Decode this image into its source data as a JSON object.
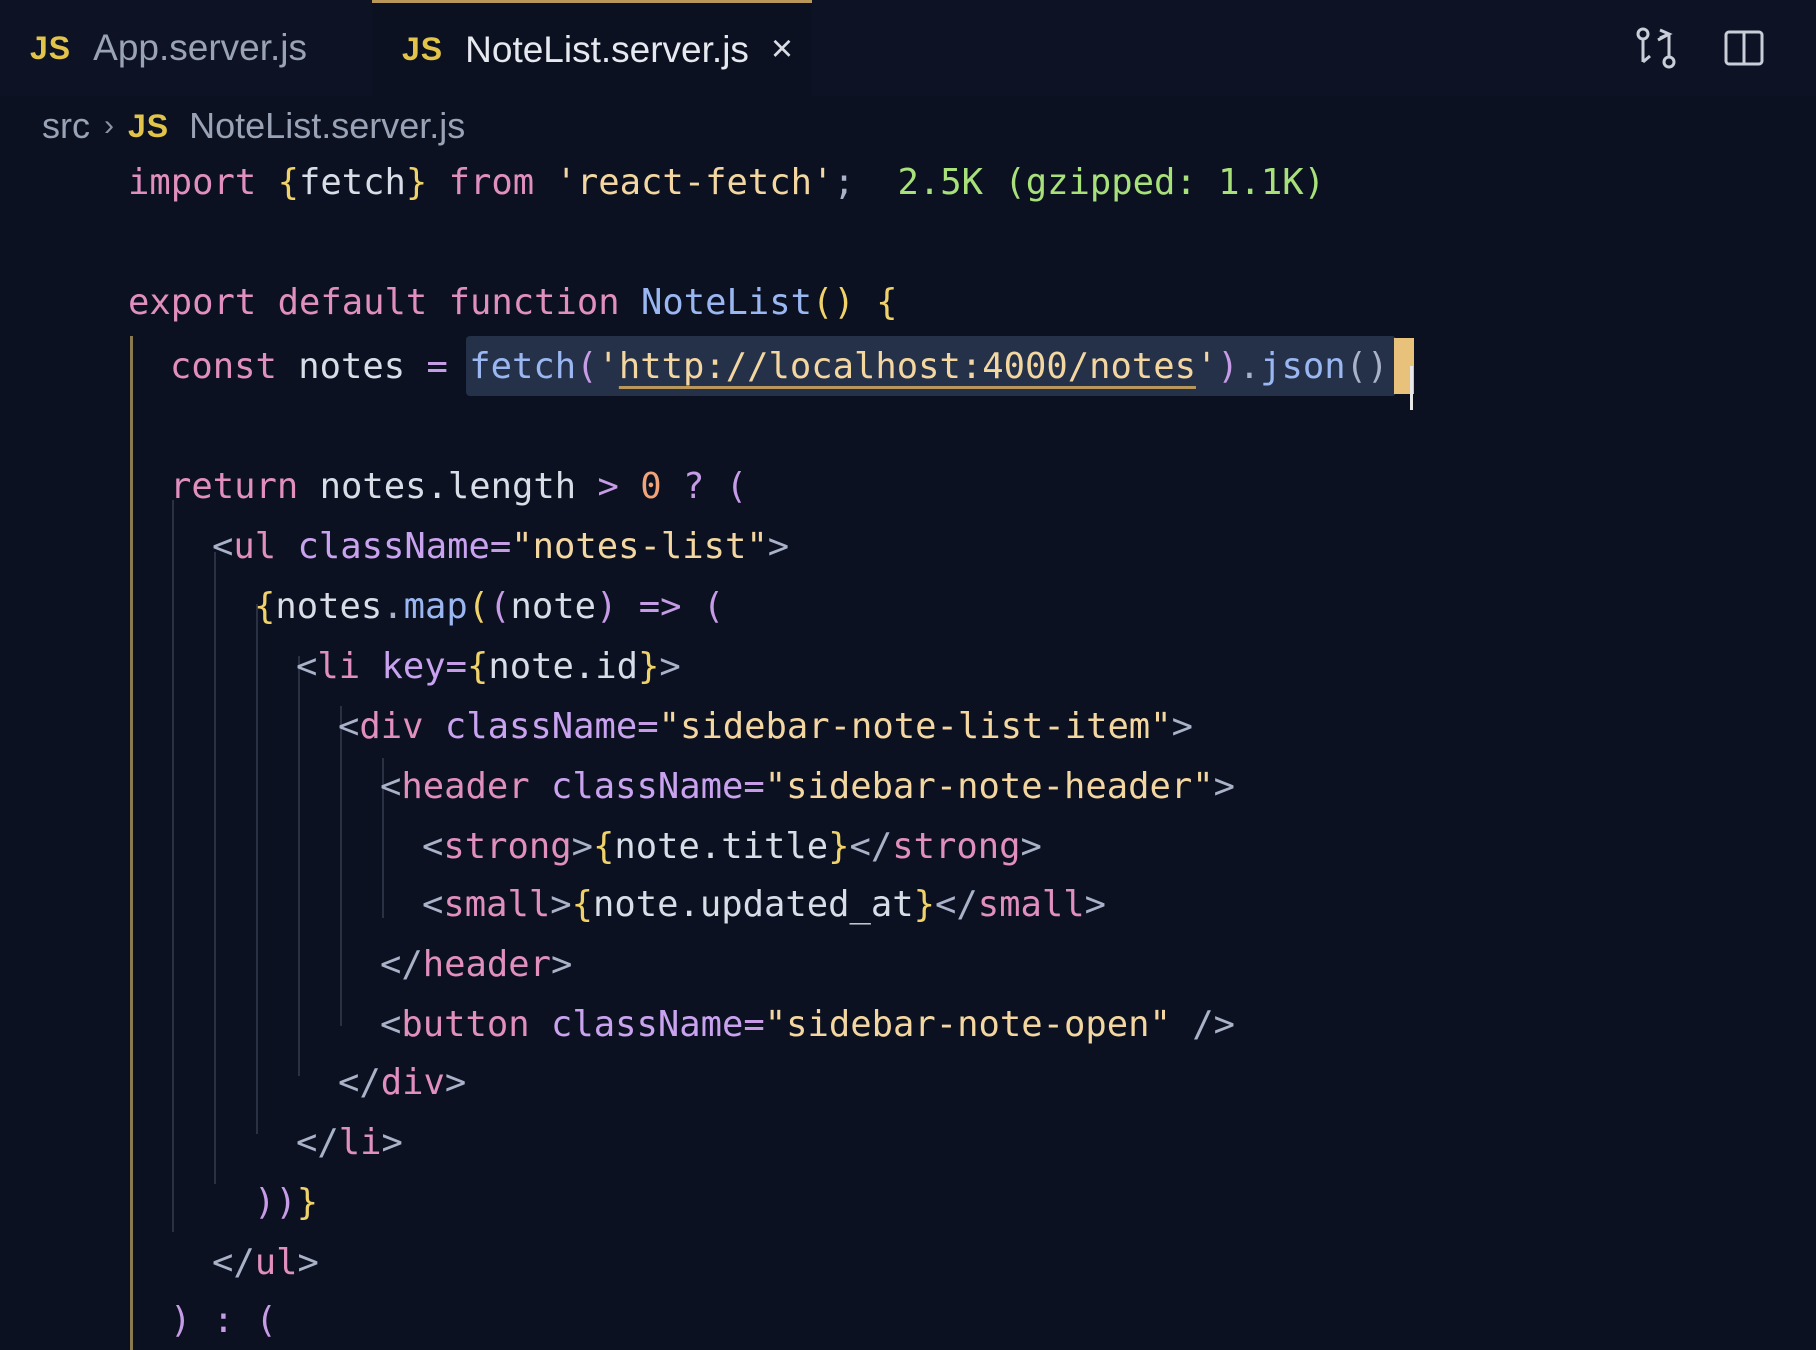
{
  "tabs": [
    {
      "badge": "JS",
      "label": "App.server.js",
      "active": false
    },
    {
      "badge": "JS",
      "label": "NoteList.server.js",
      "active": true,
      "close": "×"
    }
  ],
  "toolbar_icons": [
    "compare-changes-icon",
    "split-editor-icon"
  ],
  "breadcrumb": {
    "folder": "src",
    "separator": "›",
    "badge": "JS",
    "file": "NoteList.server.js"
  },
  "code": {
    "l1": {
      "import": "import",
      "brace_open": "{",
      "name": "fetch",
      "brace_close": "}",
      "from": "from",
      "module": "'react-fetch'",
      "semi": ";",
      "size": "2.5K (gzipped: 1.1K)"
    },
    "l3": {
      "export": "export",
      "default": "default",
      "function": "function",
      "fname": "NoteList",
      "parens": "()",
      "brace": "{"
    },
    "l4": {
      "const": "const",
      "var": "notes",
      "eq": "=",
      "fetch": "fetch",
      "paren_open": "(",
      "q1": "'",
      "url": "http://localhost:4000/notes",
      "q2": "'",
      "paren_close": ")",
      "dot": ".",
      "json": "json",
      "call": "();"
    },
    "l6": {
      "return": "return",
      "expr": "notes.length",
      "gt": ">",
      "zero": "0",
      "q": "?",
      "paren": "("
    },
    "l7": {
      "open": "<",
      "tag": "ul",
      "attr": "className",
      "eq": "=",
      "val": "\"notes-list\"",
      "close": ">"
    },
    "l8": {
      "brace": "{",
      "obj": "notes",
      "dot": ".",
      "map": "map",
      "p1": "(",
      "p2": "(",
      "arg": "note",
      "p3": ")",
      "arrow": "=>",
      "p4": "("
    },
    "l9": {
      "open": "<",
      "tag": "li",
      "attr": "key",
      "eq": "=",
      "b1": "{",
      "expr": "note.id",
      "b2": "}",
      "close": ">"
    },
    "l10": {
      "open": "<",
      "tag": "div",
      "attr": "className",
      "eq": "=",
      "val": "\"sidebar-note-list-item\"",
      "close": ">"
    },
    "l11": {
      "open": "<",
      "tag": "header",
      "attr": "className",
      "eq": "=",
      "val": "\"sidebar-note-header\"",
      "close": ">"
    },
    "l12": {
      "open": "<",
      "tag": "strong",
      "close": ">",
      "b1": "{",
      "expr": "note.title",
      "b2": "}",
      "eopen": "</",
      "etag": "strong",
      "eclose": ">"
    },
    "l13": {
      "open": "<",
      "tag": "small",
      "close": ">",
      "b1": "{",
      "expr": "note.updated_at",
      "b2": "}",
      "eopen": "</",
      "etag": "small",
      "eclose": ">"
    },
    "l14": {
      "open": "</",
      "tag": "header",
      "close": ">"
    },
    "l15": {
      "open": "<",
      "tag": "button",
      "attr": "className",
      "eq": "=",
      "val": "\"sidebar-note-open\"",
      "close": " />"
    },
    "l16": {
      "open": "</",
      "tag": "div",
      "close": ">"
    },
    "l17": {
      "open": "</",
      "tag": "li",
      "close": ">"
    },
    "l18": {
      "p1": "))",
      "b": "}"
    },
    "l19": {
      "open": "</",
      "tag": "ul",
      "close": ">"
    },
    "l20": {
      "p": ")",
      "colon": ":",
      "p2": "("
    }
  }
}
